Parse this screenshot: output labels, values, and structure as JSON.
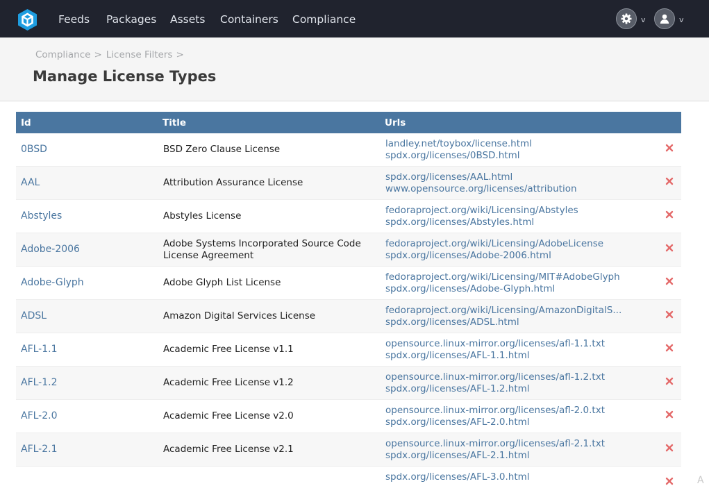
{
  "nav": {
    "items": [
      "Feeds",
      "Packages",
      "Assets",
      "Containers",
      "Compliance"
    ],
    "settings_caret": "v",
    "user_caret": "v",
    "icons": {
      "logo": "hexagon-logo-icon",
      "settings": "gear-icon",
      "user": "user-icon"
    },
    "colors": {
      "bg": "#20232e",
      "accent": "#1e9de0"
    }
  },
  "breadcrumb": [
    "Compliance",
    "License Filters"
  ],
  "breadcrumb_sep": ">",
  "page_title": "Manage License Types",
  "table": {
    "columns": [
      "Id",
      "Title",
      "Urls"
    ],
    "header_color": "#4a76a0",
    "delete_color": "#e46a6a",
    "rows": [
      {
        "id": "0BSD",
        "title": "BSD Zero Clause License",
        "urls": [
          "landley.net/toybox/license.html",
          "spdx.org/licenses/0BSD.html"
        ]
      },
      {
        "id": "AAL",
        "title": "Attribution Assurance License",
        "urls": [
          "spdx.org/licenses/AAL.html",
          "www.opensource.org/licenses/attribution"
        ]
      },
      {
        "id": "Abstyles",
        "title": "Abstyles License",
        "urls": [
          "fedoraproject.org/wiki/Licensing/Abstyles",
          "spdx.org/licenses/Abstyles.html"
        ]
      },
      {
        "id": "Adobe-2006",
        "title": "Adobe Systems Incorporated Source Code License Agreement",
        "urls": [
          "fedoraproject.org/wiki/Licensing/AdobeLicense",
          "spdx.org/licenses/Adobe-2006.html"
        ]
      },
      {
        "id": "Adobe-Glyph",
        "title": "Adobe Glyph List License",
        "urls": [
          "fedoraproject.org/wiki/Licensing/MIT#AdobeGlyph",
          "spdx.org/licenses/Adobe-Glyph.html"
        ]
      },
      {
        "id": "ADSL",
        "title": "Amazon Digital Services License",
        "urls": [
          "fedoraproject.org/wiki/Licensing/AmazonDigitalS...",
          "spdx.org/licenses/ADSL.html"
        ]
      },
      {
        "id": "AFL-1.1",
        "title": "Academic Free License v1.1",
        "urls": [
          "opensource.linux-mirror.org/licenses/afl-1.1.txt",
          "spdx.org/licenses/AFL-1.1.html"
        ]
      },
      {
        "id": "AFL-1.2",
        "title": "Academic Free License v1.2",
        "urls": [
          "opensource.linux-mirror.org/licenses/afl-1.2.txt",
          "spdx.org/licenses/AFL-1.2.html"
        ]
      },
      {
        "id": "AFL-2.0",
        "title": "Academic Free License v2.0",
        "urls": [
          "opensource.linux-mirror.org/licenses/afl-2.0.txt",
          "spdx.org/licenses/AFL-2.0.html"
        ]
      },
      {
        "id": "AFL-2.1",
        "title": "Academic Free License v2.1",
        "urls": [
          "opensource.linux-mirror.org/licenses/afl-2.1.txt",
          "spdx.org/licenses/AFL-2.1.html"
        ]
      },
      {
        "id": "",
        "title": "",
        "urls": [
          "spdx.org/licenses/AFL-3.0.html"
        ]
      }
    ]
  },
  "watermark": "A"
}
